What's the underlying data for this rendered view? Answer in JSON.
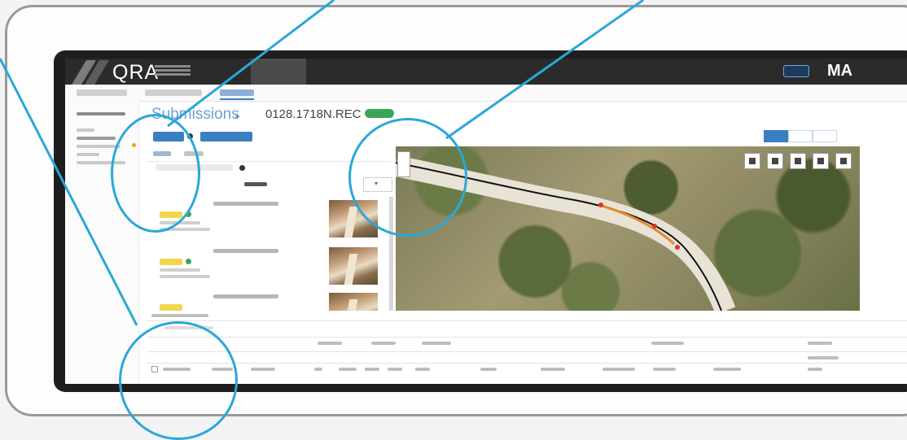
{
  "app": {
    "logo_text": "QRA",
    "logo_subtitle": "",
    "right_brand": "MA"
  },
  "nav": {
    "items": [
      {
        "label": "",
        "active": false
      },
      {
        "label": "",
        "active": true
      },
      {
        "label": "",
        "active": false
      }
    ],
    "button_label": ""
  },
  "subtabs": [
    {
      "label": "",
      "active": false
    },
    {
      "label": "",
      "active": false
    },
    {
      "label": "",
      "active": true
    }
  ],
  "sidebar": {
    "header": "",
    "items": [
      {
        "label": "",
        "selected": false
      },
      {
        "label": "",
        "selected": true
      },
      {
        "label": "",
        "selected": false,
        "flag": "warning-dot"
      },
      {
        "label": "",
        "selected": false
      },
      {
        "label": "",
        "selected": false
      }
    ]
  },
  "page": {
    "title": "Submissions",
    "title_action": "+",
    "record_id": "0128.1718N.REC",
    "status_badge": ""
  },
  "toolbar": {
    "primary_button": "",
    "secondary_button": "",
    "view_toggles": [
      "",
      "",
      ""
    ]
  },
  "panel": {
    "tabs": [
      "",
      ""
    ],
    "filter_placeholder": "",
    "photos_count_label": "",
    "sort_label": ""
  },
  "photos": [
    {
      "name": "",
      "tag": "",
      "meta": [
        "",
        ""
      ]
    },
    {
      "name": "",
      "tag": "",
      "meta": [
        "",
        ""
      ]
    },
    {
      "name": "",
      "tag": "",
      "meta": [
        "",
        ""
      ]
    }
  ],
  "map": {
    "controls": [
      "layers-icon",
      "fullscreen-icon",
      "ruler-icon",
      "location-icon",
      "more-icon"
    ]
  },
  "table": {
    "toolbar_label": "",
    "search_placeholder": "",
    "group_headers": [
      "",
      "",
      "",
      "",
      ""
    ],
    "columns": [
      "",
      "",
      "",
      "",
      "",
      "",
      "",
      "",
      "",
      "",
      "",
      "",
      "",
      ""
    ]
  },
  "colors": {
    "accent": "#3a7fc1",
    "callout": "#29a8d8",
    "status_green": "#3aa655",
    "tag_yellow": "#f2d64b",
    "nav_bg": "#2b2b2b"
  }
}
